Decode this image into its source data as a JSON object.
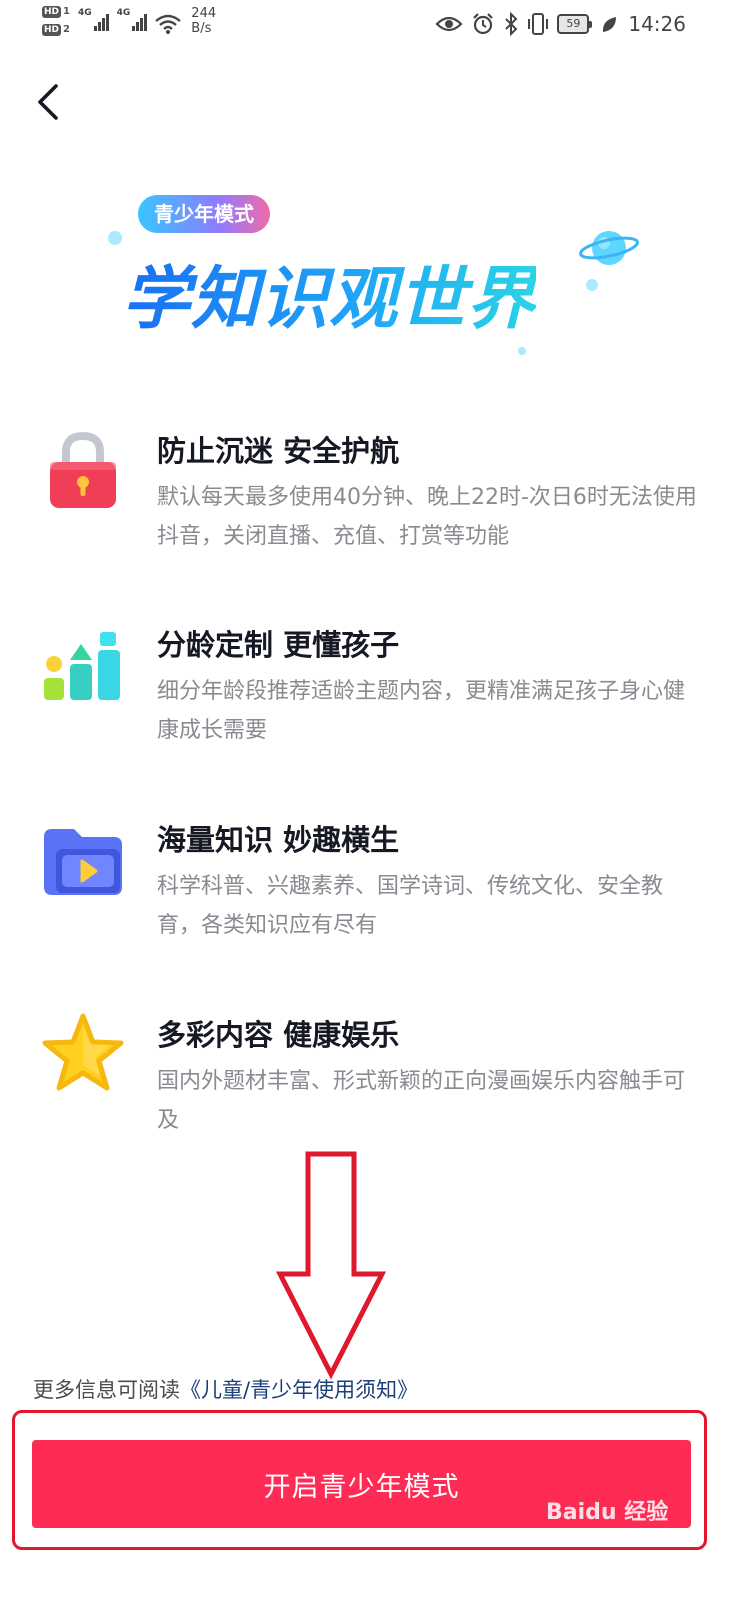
{
  "status_bar": {
    "sim1": "HD",
    "sim1_num": "1",
    "sim2": "HD",
    "sim2_num": "2",
    "net1": "4G",
    "net2": "4G",
    "speed_value": "244",
    "speed_unit": "B/s",
    "battery": "59",
    "time": "14:26"
  },
  "header": {
    "back_icon": "chevron-left-icon"
  },
  "banner": {
    "badge": "青少年模式",
    "headline": "学知识观世界"
  },
  "features": [
    {
      "icon": "lock-icon",
      "title": "防止沉迷 安全护航",
      "desc": "默认每天最多使用40分钟、晚上22时-次日6时无法使用抖音，关闭直播、充值、打赏等功能"
    },
    {
      "icon": "bar-chart-icon",
      "title": "分龄定制 更懂孩子",
      "desc": "细分年龄段推荐适龄主题内容，更精准满足孩子身心健康成长需要"
    },
    {
      "icon": "video-folder-icon",
      "title": "海量知识 妙趣横生",
      "desc": "科学科普、兴趣素养、国学诗词、传统文化、安全教育，各类知识应有尽有"
    },
    {
      "icon": "star-icon",
      "title": "多彩内容 健康娱乐",
      "desc": "国内外题材丰富、形式新颖的正向漫画娱乐内容触手可及"
    }
  ],
  "footer": {
    "notice_prefix": "更多信息可阅读",
    "notice_link": "《儿童/青少年使用须知》",
    "cta_label": "开启青少年模式",
    "watermark": "Baidu 经验"
  },
  "colors": {
    "accent": "#fe2c55",
    "annotation": "#e0182d",
    "title": "#161823",
    "desc": "#8a8b91"
  }
}
